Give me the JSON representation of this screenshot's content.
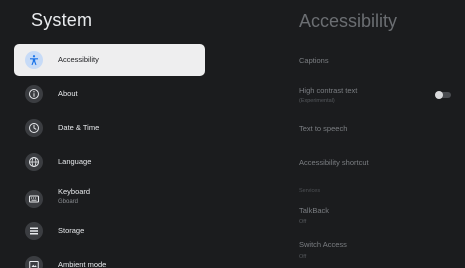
{
  "left_panel": {
    "title": "System",
    "items": [
      {
        "label": "Accessibility",
        "icon": "accessibility-icon",
        "selected": true
      },
      {
        "label": "About",
        "icon": "info-icon"
      },
      {
        "label": "Date & Time",
        "icon": "clock-icon"
      },
      {
        "label": "Language",
        "icon": "globe-icon"
      },
      {
        "label": "Keyboard",
        "sublabel": "Gboard",
        "icon": "keyboard-icon"
      },
      {
        "label": "Storage",
        "icon": "storage-icon"
      },
      {
        "label": "Ambient mode",
        "icon": "ambient-mode-icon"
      }
    ]
  },
  "right_panel": {
    "title": "Accessibility",
    "options": {
      "captions": "Captions",
      "high_contrast": {
        "label": "High contrast text",
        "sublabel": "(Experimental)",
        "toggle_on": false
      },
      "tts": "Text to speech",
      "shortcut": "Accessibility shortcut",
      "services_header": "Services",
      "talkback": {
        "label": "TalkBack",
        "sublabel": "Off"
      },
      "switch_access": {
        "label": "Switch Access",
        "sublabel": "Off"
      }
    }
  },
  "colors": {
    "background": "#1b1c1e",
    "selected_item_bg": "#eeeeef",
    "selected_icon_bg": "#c7dbf7",
    "icon_bg": "#3b3d41"
  }
}
